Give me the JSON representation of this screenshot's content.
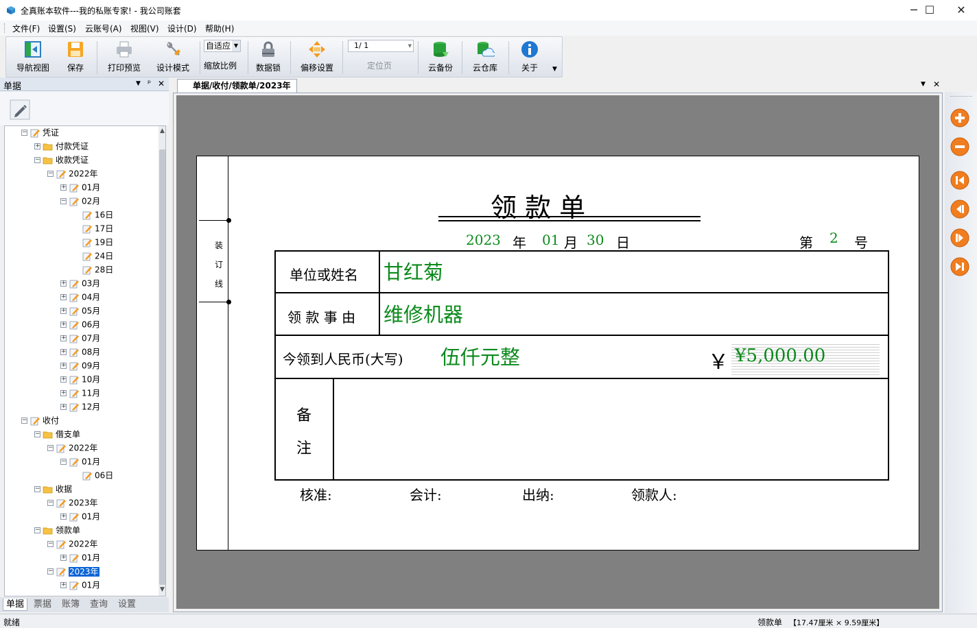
{
  "window": {
    "title": "全真账本软件---我的私账专家!  - 我公司账套",
    "minimize_glyph": "─",
    "maximize_glyph": "☐",
    "close_glyph": "✕"
  },
  "menu": [
    "文件(F)",
    "设置(S)",
    "云账号(A)",
    "视图(V)",
    "设计(D)",
    "帮助(H)"
  ],
  "toolbar": {
    "nav_view": "导航视图",
    "save": "保存",
    "print_preview": "打印预览",
    "design_mode": "设计模式",
    "zoom_value": "自适应",
    "zoom_label": "缩放比例",
    "data_lock": "数据锁",
    "offset_settings": "偏移设置",
    "page_value": "1/  1",
    "page_label": "定位页",
    "cloud_backup": "云备份",
    "cloud_repo": "云仓库",
    "about": "关于"
  },
  "left_panel": {
    "title": "单据",
    "pin_glyph": "ᵖ",
    "close_glyph": "✕",
    "dropdown_glyph": "▼",
    "tree": [
      {
        "label": "凭证",
        "level": 1,
        "exp": "−",
        "icon": "doc"
      },
      {
        "label": "付款凭证",
        "level": 2,
        "exp": "+",
        "icon": "folder"
      },
      {
        "label": "收款凭证",
        "level": 2,
        "exp": "−",
        "icon": "folder"
      },
      {
        "label": "2022年",
        "level": 3,
        "exp": "−",
        "icon": "doc"
      },
      {
        "label": "01月",
        "level": 4,
        "exp": "+",
        "icon": "doc"
      },
      {
        "label": "02月",
        "level": 4,
        "exp": "−",
        "icon": "doc"
      },
      {
        "label": "16日",
        "level": 5,
        "exp": "",
        "icon": "doc"
      },
      {
        "label": "17日",
        "level": 5,
        "exp": "",
        "icon": "doc"
      },
      {
        "label": "19日",
        "level": 5,
        "exp": "",
        "icon": "doc"
      },
      {
        "label": "24日",
        "level": 5,
        "exp": "",
        "icon": "doc"
      },
      {
        "label": "28日",
        "level": 5,
        "exp": "",
        "icon": "doc"
      },
      {
        "label": "03月",
        "level": 4,
        "exp": "+",
        "icon": "doc"
      },
      {
        "label": "04月",
        "level": 4,
        "exp": "+",
        "icon": "doc"
      },
      {
        "label": "05月",
        "level": 4,
        "exp": "+",
        "icon": "doc"
      },
      {
        "label": "06月",
        "level": 4,
        "exp": "+",
        "icon": "doc"
      },
      {
        "label": "07月",
        "level": 4,
        "exp": "+",
        "icon": "doc"
      },
      {
        "label": "08月",
        "level": 4,
        "exp": "+",
        "icon": "doc"
      },
      {
        "label": "09月",
        "level": 4,
        "exp": "+",
        "icon": "doc"
      },
      {
        "label": "10月",
        "level": 4,
        "exp": "+",
        "icon": "doc"
      },
      {
        "label": "11月",
        "level": 4,
        "exp": "+",
        "icon": "doc"
      },
      {
        "label": "12月",
        "level": 4,
        "exp": "+",
        "icon": "doc"
      },
      {
        "label": "收付",
        "level": 1,
        "exp": "−",
        "icon": "doc"
      },
      {
        "label": "借支单",
        "level": 2,
        "exp": "−",
        "icon": "folder"
      },
      {
        "label": "2022年",
        "level": 3,
        "exp": "−",
        "icon": "doc"
      },
      {
        "label": "01月",
        "level": 4,
        "exp": "−",
        "icon": "doc"
      },
      {
        "label": "06日",
        "level": 5,
        "exp": "",
        "icon": "doc"
      },
      {
        "label": "收据",
        "level": 2,
        "exp": "−",
        "icon": "folder"
      },
      {
        "label": "2023年",
        "level": 3,
        "exp": "−",
        "icon": "doc"
      },
      {
        "label": "01月",
        "level": 4,
        "exp": "+",
        "icon": "doc"
      },
      {
        "label": "领款单",
        "level": 2,
        "exp": "−",
        "icon": "folder"
      },
      {
        "label": "2022年",
        "level": 3,
        "exp": "−",
        "icon": "doc"
      },
      {
        "label": "01月",
        "level": 4,
        "exp": "+",
        "icon": "doc"
      },
      {
        "label": "2023年",
        "level": 3,
        "exp": "−",
        "icon": "doc",
        "selected": true
      },
      {
        "label": "01月",
        "level": 4,
        "exp": "+",
        "icon": "doc"
      }
    ],
    "tabs": [
      "单据",
      "票据",
      "账簿",
      "查询",
      "设置"
    ]
  },
  "document": {
    "tab_title": "单据/收付/领款单/2023年",
    "tab_menu_glyph": "▼",
    "tab_close_glyph": "✕",
    "form": {
      "binding_line": "装  订  线",
      "title": "领   款   单",
      "year": "2023",
      "year_unit": "年",
      "month": "01",
      "month_unit": "月",
      "day": "30",
      "day_unit": "日",
      "no_prefix": "第",
      "number": "2",
      "no_suffix": "号",
      "payee_label": "单位或姓名",
      "payee_value": "甘红菊",
      "reason_label": "领 款 事 由",
      "reason_value": "维修机器",
      "amount_label": "今领到人民币(大写)",
      "amount_words": "伍仟元整",
      "currency_symbol": "￥",
      "amount_number": "¥5,000.00",
      "remarks_label_1": "备",
      "remarks_label_2": "注",
      "approve": "核准:",
      "accountant": "会计:",
      "cashier": "出纳:",
      "receiver": "领款人:"
    }
  },
  "status": {
    "left": "就绪",
    "doc_name": "领款单",
    "size": "【17.47厘米  ×   9.59厘米】"
  },
  "colors": {
    "accent_green": "#0c8a1c",
    "nav_orange": "#f07d1f",
    "selection_blue": "#0a64d6"
  }
}
